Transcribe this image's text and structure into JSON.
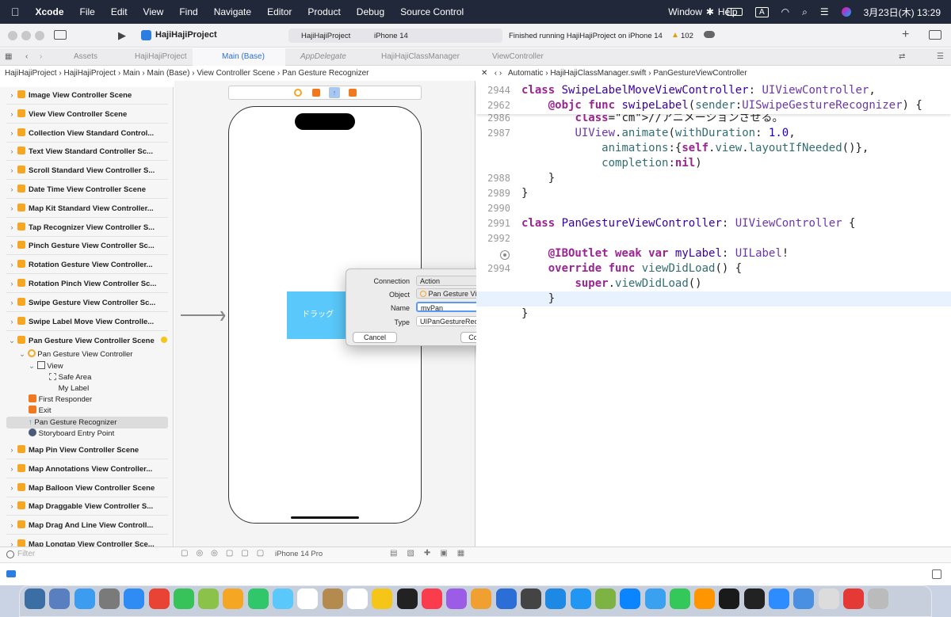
{
  "menubar": {
    "app_name": "Xcode",
    "items": [
      "File",
      "Edit",
      "View",
      "Find",
      "Navigate",
      "Editor",
      "Product",
      "Debug",
      "Source Control",
      "Window",
      "Help"
    ],
    "input_mode": "A",
    "clock": "3月23日(木) 13:29"
  },
  "toolbar": {
    "project": "HajiHajiProject",
    "scheme": "HajiHajiProject",
    "device": "iPhone 14",
    "status": "Finished running HajiHajiProject on iPhone 14",
    "warnings": "102"
  },
  "tabs": [
    "Assets",
    "HajiHajiProject",
    "Main (Base)",
    "AppDelegate",
    "HajiHajiClassManager",
    "ViewController"
  ],
  "jumpbar_left": [
    "HajiHajiProject",
    "HajiHajiProject",
    "Main",
    "Main (Base)",
    "View Controller Scene",
    "Pan Gesture Recognizer"
  ],
  "jumpbar_right": [
    "Automatic",
    "HajiHajiClassManager.swift",
    "PanGestureViewController"
  ],
  "scenes_top": [
    "Image View Controller Scene",
    "View View Controller Scene",
    "Collection View Standard Control...",
    "Text View Standard Controller Sc...",
    "Scroll Standard View Controller S...",
    "Date Time View Controller Scene",
    "Map Kit Standard View Controller...",
    "Tap Recognizer View Controller S...",
    "Pinch Gesture View Controller Sc...",
    "Rotation Gesture View Controller...",
    "Rotation Pinch View Controller Sc...",
    "Swipe Gesture View Controller Sc...",
    "Swipe Label Move View Controlle..."
  ],
  "expanded_scene": {
    "title": "Pan Gesture View Controller Scene",
    "controller": "Pan Gesture View Controller",
    "view": "View",
    "safe_area": "Safe Area",
    "label": "My Label",
    "first_responder": "First Responder",
    "exit": "Exit",
    "recognizer": "Pan Gesture Recognizer",
    "entry": "Storyboard Entry Point"
  },
  "scenes_bottom": [
    "Map Pin View Controller Scene",
    "Map Annotations View Controller...",
    "Map Balloon View Controller Scene",
    "Map Draggable View Controller S...",
    "Map Drag And Line View Controll...",
    "Map Longtap View Controller Sce..."
  ],
  "filter_placeholder": "Filter",
  "canvas": {
    "label_text": "ドラッグ",
    "device_label": "iPhone 14 Pro"
  },
  "dialog": {
    "connection_label": "Connection",
    "connection_value": "Action",
    "object_label": "Object",
    "object_value": "Pan Gesture View...",
    "name_label": "Name",
    "name_value": "myPan",
    "type_label": "Type",
    "type_value": "UIPanGestureRecogni",
    "cancel": "Cancel",
    "connect": "Connect"
  },
  "code": {
    "sticky1_ln": "2944",
    "sticky2_ln": "2962",
    "lines": [
      {
        "ln": "2986",
        "text": "        //アニメーションさせる。"
      },
      {
        "ln": "2987",
        "text": "        UIView.animate(withDuration: 1.0,"
      },
      {
        "ln": "",
        "text": "            animations:{self.view.layoutIfNeeded()},"
      },
      {
        "ln": "",
        "text": "            completion:nil)"
      },
      {
        "ln": "2988",
        "text": "    }"
      },
      {
        "ln": "2989",
        "text": "}"
      },
      {
        "ln": "2990",
        "text": ""
      },
      {
        "ln": "2991",
        "text": "class PanGestureViewController: UIViewController {"
      },
      {
        "ln": "2992",
        "text": ""
      },
      {
        "ln": "",
        "text": "    @IBOutlet weak var myLabel: UILabel!"
      },
      {
        "ln": "2994",
        "text": "    override func viewDidLoad() {"
      },
      {
        "ln": "",
        "text": "        super.viewDidLoad()"
      },
      {
        "ln": "",
        "text": "    }"
      },
      {
        "ln": "",
        "text": "}"
      }
    ],
    "sticky1": "class SwipeLabelMoveViewController: UIViewController,",
    "sticky2": "    @objc func swipeLabel(sender:UISwipeGestureRecognizer) {"
  }
}
